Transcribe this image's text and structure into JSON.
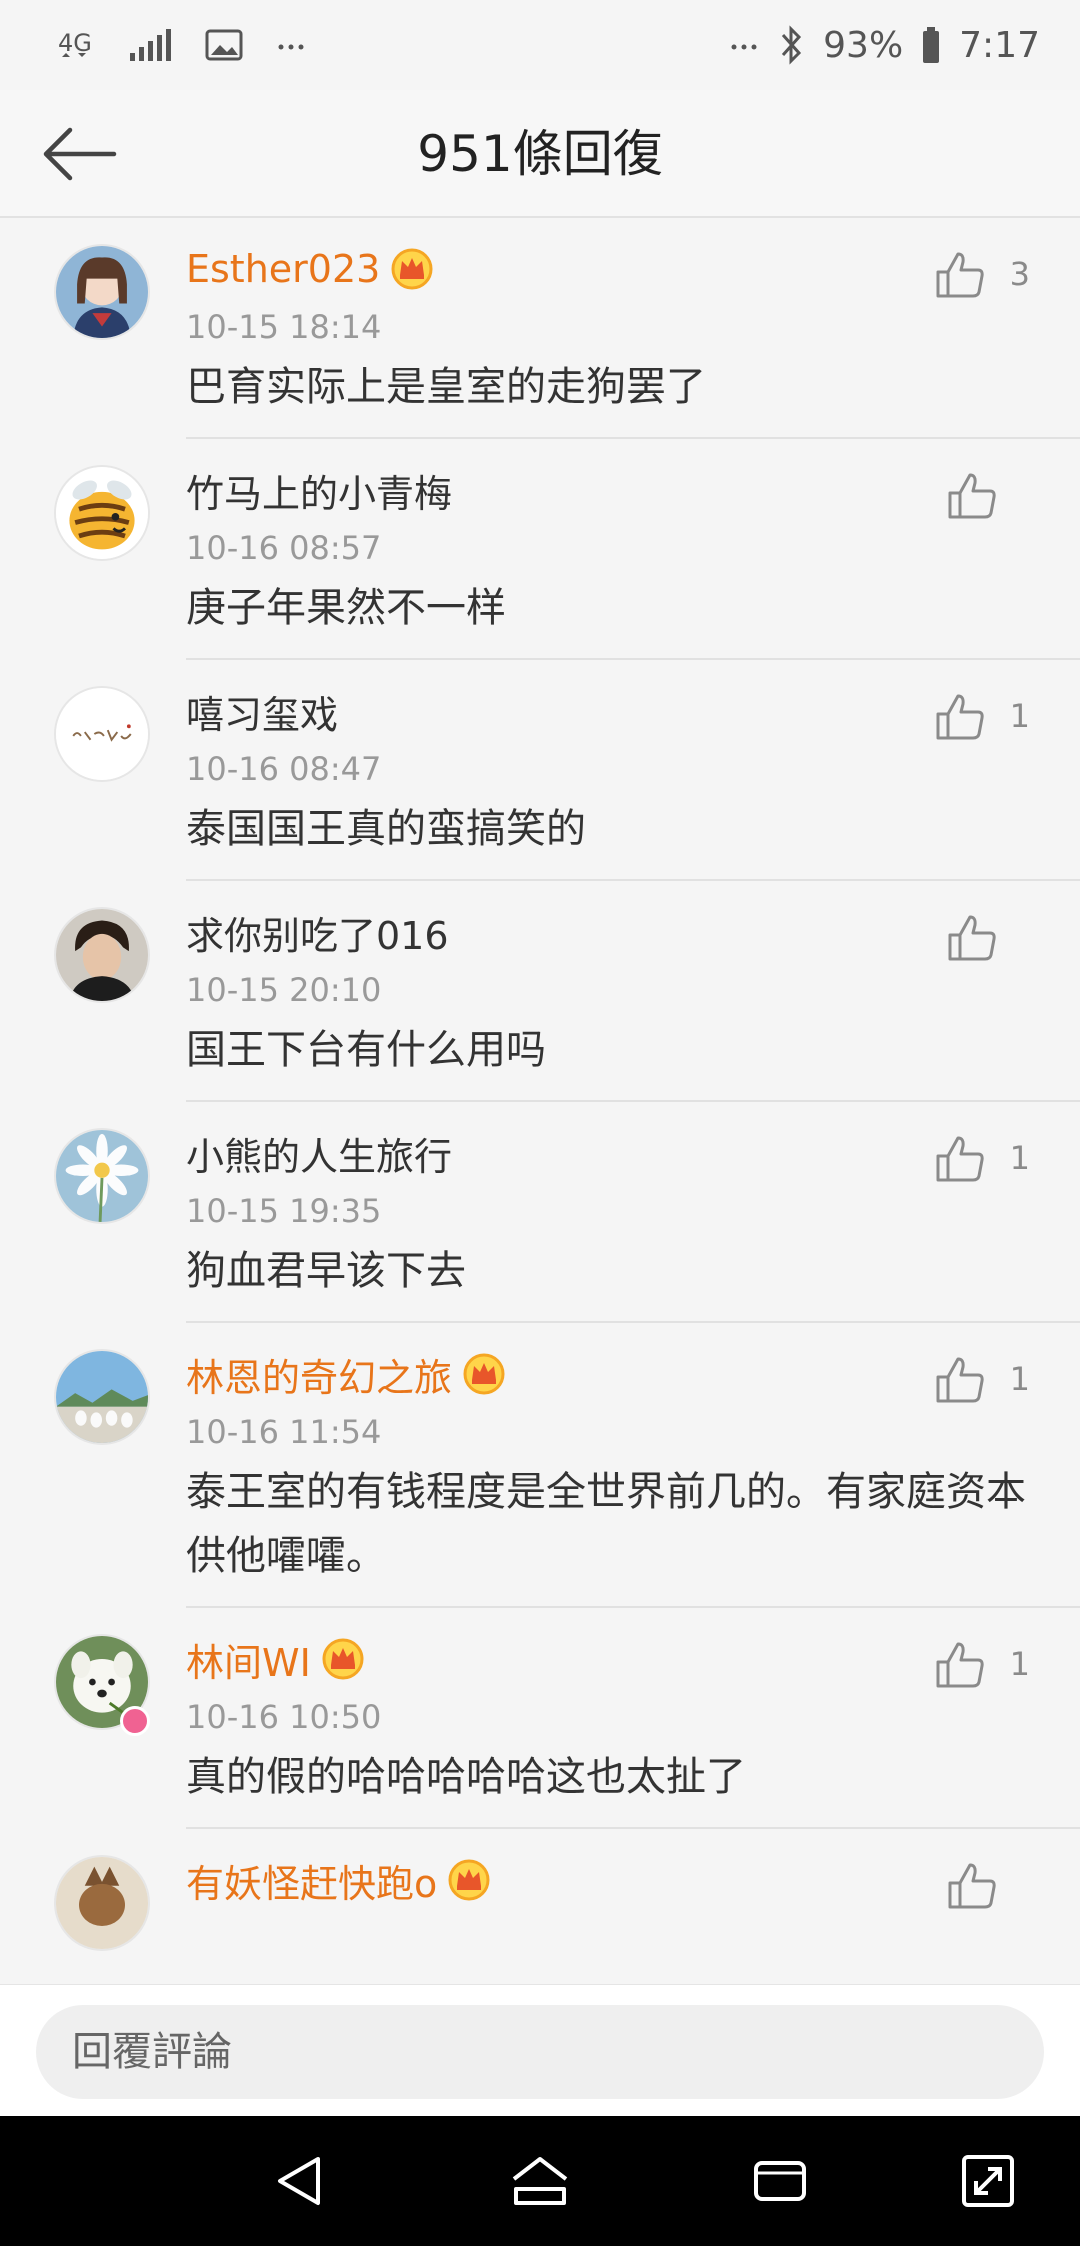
{
  "status_bar": {
    "network": "4G",
    "battery": "93%",
    "time": "7:17",
    "icons": [
      "4g-icon",
      "signal-icon",
      "image-icon",
      "more-dots-icon",
      "bluetooth-icon",
      "battery-icon"
    ]
  },
  "header": {
    "title": "951條回復",
    "back_icon": "back-arrow-icon"
  },
  "comments": [
    {
      "username": "Esther023",
      "vip": true,
      "time": "10-15 18:14",
      "text": "巴育实际上是皇室的走狗罢了",
      "likes": "3"
    },
    {
      "username": "竹马上的小青梅",
      "vip": false,
      "time": "10-16 08:57",
      "text": "庚子年果然不一样",
      "likes": ""
    },
    {
      "username": "嘻习玺戏",
      "vip": false,
      "time": "10-16 08:47",
      "text": "泰国国王真的蛮搞笑的",
      "likes": "1"
    },
    {
      "username": "求你别吃了016",
      "vip": false,
      "time": "10-15 20:10",
      "text": "国王下台有什么用吗",
      "likes": ""
    },
    {
      "username": "小熊的人生旅行",
      "vip": false,
      "time": "10-15 19:35",
      "text": "狗血君早该下去",
      "likes": "1"
    },
    {
      "username": "林恩的奇幻之旅",
      "vip": true,
      "time": "10-16 11:54",
      "text": "泰王室的有钱程度是全世界前几的。有家庭资本供他嚯嚯。",
      "likes": "1"
    },
    {
      "username": "林间WI",
      "vip": true,
      "time": "10-16 10:50",
      "text": "真的假的哈哈哈哈哈这也太扯了",
      "likes": "1"
    },
    {
      "username": "有妖怪赶快跑o",
      "vip": true,
      "time": "",
      "text": "",
      "likes": ""
    }
  ],
  "reply_bar": {
    "placeholder": "回覆評論"
  },
  "nav_bar": {
    "icons": [
      "back-triangle-icon",
      "home-icon",
      "recents-icon",
      "expand-icon"
    ]
  },
  "colors": {
    "vip_name": "#e8751a",
    "background": "#f5f5f5",
    "time_text": "#999999"
  }
}
